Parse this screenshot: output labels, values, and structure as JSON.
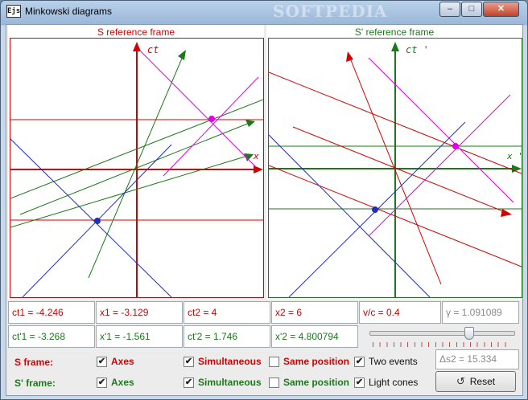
{
  "window": {
    "icon_label": "Ejs",
    "title": "Minkowski diagrams",
    "watermark": "SOFTPEDIA",
    "minimize": "–",
    "maximize": "□",
    "close": "✕"
  },
  "panels": {
    "s": {
      "title": "S reference frame",
      "axis_ct": "ct",
      "axis_x": "x"
    },
    "sprime": {
      "title": "S' reference frame",
      "axis_ct": "ct '",
      "axis_x": "x '"
    }
  },
  "fields": {
    "ct1": "ct1 = -4.246",
    "x1": "x1 = -3.129",
    "ct2": "ct2 = 4",
    "x2": "x2 = 6",
    "vc": "v/c = 0.4",
    "gamma": "γ = 1.091089",
    "ctp1": "ct'1 = -3.268",
    "xp1": "x'1 = -1.561",
    "ctp2": "ct'2 = 1.746",
    "xp2": "x'2 = 4.800794",
    "ds2": "Δs2 = 15.334"
  },
  "slider": {
    "value_fraction": 0.7
  },
  "controls": {
    "s_frame_label": "S frame:",
    "sp_frame_label": "S' frame:",
    "axes": "Axes",
    "simultaneous": "Simultaneous",
    "same_position": "Same position",
    "two_events": "Two events",
    "light_cones": "Light cones",
    "reset": "Reset",
    "checked_mark": "✔"
  },
  "colors": {
    "s_frame": "#d40000",
    "sprime_frame": "#1a7a1a",
    "light": "#1f2fb8",
    "event2": "#e000e0"
  }
}
